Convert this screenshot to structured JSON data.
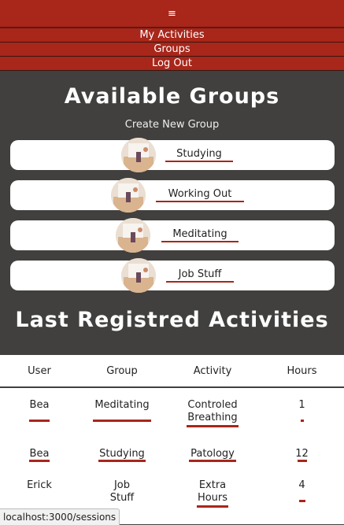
{
  "nav": {
    "menu_icon": "hamburger-icon",
    "menu_glyph": "≡",
    "links": [
      "My Activities",
      "Groups",
      "Log Out"
    ]
  },
  "groups_section": {
    "title": "Available Groups",
    "create_label": "Create New Group",
    "groups": [
      "Studying",
      "Working Out",
      "Meditating",
      "Job Stuff"
    ]
  },
  "activities_section": {
    "title": "Last Registred Activities",
    "columns": [
      "User",
      "Group",
      "Activity",
      "Hours"
    ],
    "rows": [
      {
        "user": "Bea",
        "group": "Meditating",
        "activity": "Controled Breathing",
        "hours": "1"
      },
      {
        "user": "Bea",
        "group": "Studying",
        "activity": "Patology",
        "hours": "12"
      },
      {
        "user": "Erick",
        "group": "Job Stuff",
        "activity": "Extra Hours",
        "hours": "4"
      }
    ]
  },
  "status_bar": {
    "url": "localhost:3000/sessions"
  },
  "colors": {
    "accent": "#a8261a",
    "background": "#41403e",
    "card": "#ffffff"
  }
}
